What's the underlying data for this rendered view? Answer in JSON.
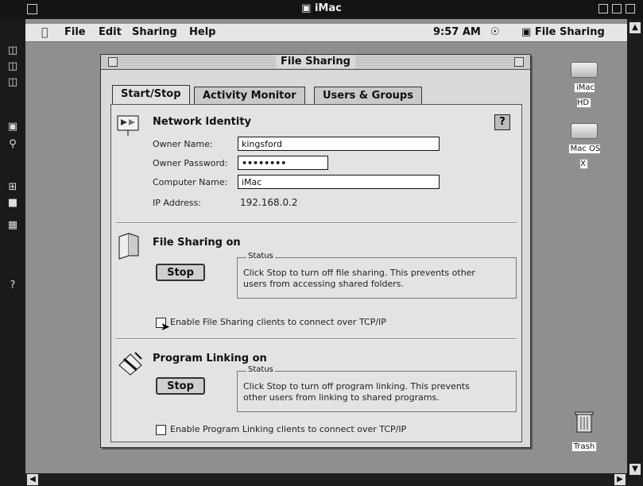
{
  "host": {
    "title": "iMac",
    "title_icon": "screen-icon"
  },
  "menubar": {
    "items": [
      "File",
      "Edit",
      "Sharing",
      "Help"
    ],
    "clock": "9:57 AM",
    "app_name": "File Sharing"
  },
  "window": {
    "title": "File Sharing",
    "tabs": [
      {
        "label": "Start/Stop",
        "active": true
      },
      {
        "label": "Activity Monitor",
        "active": false
      },
      {
        "label": "Users & Groups",
        "active": false
      }
    ]
  },
  "identity": {
    "heading": "Network Identity",
    "owner_name_label": "Owner Name:",
    "owner_name_value": "kingsford",
    "owner_password_label": "Owner Password:",
    "owner_password_value": "••••••••",
    "computer_name_label": "Computer Name:",
    "computer_name_value": "iMac",
    "ip_label": "IP Address:",
    "ip_value": "192.168.0.2",
    "help_label": "?"
  },
  "file_sharing": {
    "heading": "File Sharing on",
    "button": "Stop",
    "status_label": "Status",
    "status_text_1": "Click Stop to turn off file sharing. This prevents other",
    "status_text_2": "users from accessing shared folders.",
    "checkbox_label": "Enable File Sharing clients to connect over TCP/IP",
    "checkbox_checked": false
  },
  "program_linking": {
    "heading": "Program Linking on",
    "button": "Stop",
    "status_label": "Status",
    "status_text_1": "Click Stop to turn off program linking. This prevents",
    "status_text_2": "other users from linking to shared programs.",
    "checkbox_label": "Enable Program Linking clients to connect over TCP/IP",
    "checkbox_checked": false
  },
  "desktop_icons": [
    {
      "label": "iMac HD",
      "icon": "hard-disk-icon"
    },
    {
      "label": "Mac OS X",
      "icon": "hard-disk-icon"
    },
    {
      "label": "Trash",
      "icon": "trash-icon"
    }
  ],
  "colors": {
    "desktop": "#8f8f8f",
    "window_bg": "#dadada",
    "host_chrome": "#141414"
  }
}
